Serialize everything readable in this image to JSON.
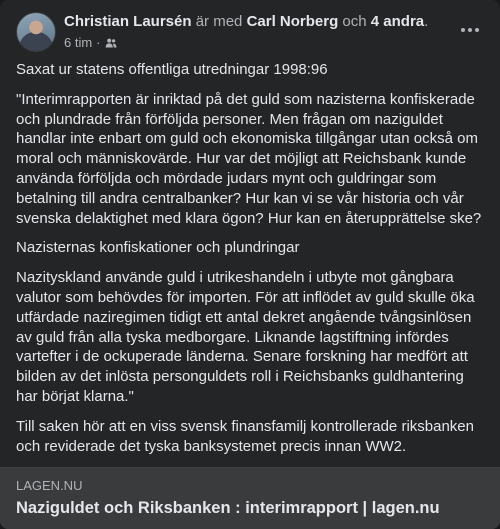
{
  "post": {
    "author": "Christian Laursén",
    "with_text": "är med",
    "tagged": "Carl Norberg",
    "and_text": "och",
    "others": "4 andra",
    "period": ".",
    "time": "6 tim",
    "dot": "·",
    "audience_icon": "friends-icon",
    "paragraphs": [
      "Saxat ur statens offentliga utredningar 1998:96",
      "\"Interimrapporten är inriktad på det guld som nazisterna konfiskerade och plundrade från förföljda personer. Men frågan om naziguldet handlar inte enbart om guld och ekonomiska tillgångar utan också om moral och människovärde. Hur var det möjligt att Reichsbank kunde använda förföljda och mördade judars mynt och guldringar som betalning till andra centralbanker? Hur kan vi se vår historia och vår svenska delaktighet med klara ögon? Hur kan en återupprättelse ske?",
      "Nazisternas konfiskationer och plundringar",
      "Nazityskland använde guld i utrikeshandeln i utbyte mot gångbara valutor som behövdes för importen. För att inflödet av guld skulle öka utfärdade naziregimen tidigt ett antal dekret angående tvångsinlösen av guld från alla tyska medborgare. Liknande lagstiftning infördes vartefter i de ockuperade länderna. Senare forskning har medfört att bilden av det inlösta personguldets roll i Reichsbanks guldhantering har börjat klarna.\"",
      "Till saken hör att en viss svensk finansfamilj kontrollerade riksbanken och reviderade det tyska banksystemet precis innan WW2."
    ]
  },
  "link": {
    "domain": "LAGEN.NU",
    "title": "Naziguldet och Riksbanken : interimrapport | lagen.nu"
  },
  "colors": {
    "card_bg": "#242526",
    "text_primary": "#e4e6eb",
    "text_secondary": "#b0b3b8",
    "link_bg": "#3a3b3c"
  }
}
